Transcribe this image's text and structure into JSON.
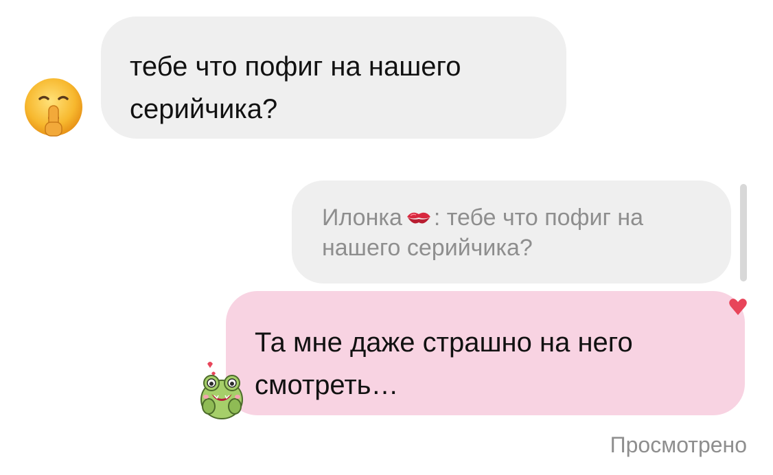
{
  "messages": {
    "incoming": {
      "text_line1": "тебе что пофиг на нашего",
      "text_line2": "серийчика?",
      "avatar_icon": "shushing-face-emoji-icon"
    },
    "reply_quote": {
      "author": "Илонка",
      "author_icon": "kiss-mark-icon",
      "separator": ":",
      "text_line1_rest": " тебе что пофиг на",
      "text_line2": "нашего серийчика?"
    },
    "outgoing": {
      "text_line1": "Та мне даже страшно на него",
      "text_line2": "смотреть…",
      "reaction_icon": "heart-icon",
      "sticker_icon": "frog-sticker-icon"
    }
  },
  "status": {
    "seen_label": "Просмотрено"
  },
  "colors": {
    "incoming_bubble": "#efefef",
    "outgoing_bubble": "#f8d3e2",
    "muted_text": "#8e8e8e",
    "heart": "#e8455a"
  }
}
